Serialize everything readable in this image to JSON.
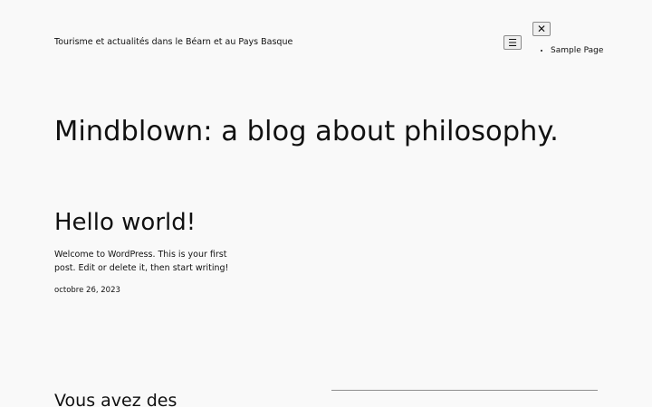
{
  "header": {
    "tagline": "Tourisme et actualités dans le Béarn et au Pays Basque",
    "menu_open_label": "☰",
    "menu_close_label": "✕",
    "nav_items": [
      {
        "label": "Sample Page"
      }
    ]
  },
  "main": {
    "site_title": "Mindblown: a blog about philosophy.",
    "posts": [
      {
        "title": "Hello world!",
        "excerpt": "Welcome to WordPress. This is your first post. Edit or delete it, then start writing!",
        "date": "octobre 26, 2023"
      }
    ]
  },
  "footer": {
    "heading": "Vous avez des"
  },
  "colors": {
    "background": "#f9f9f9",
    "text": "#111111",
    "button_border": "#8a8a8a",
    "divider": "#8e8e8e"
  }
}
